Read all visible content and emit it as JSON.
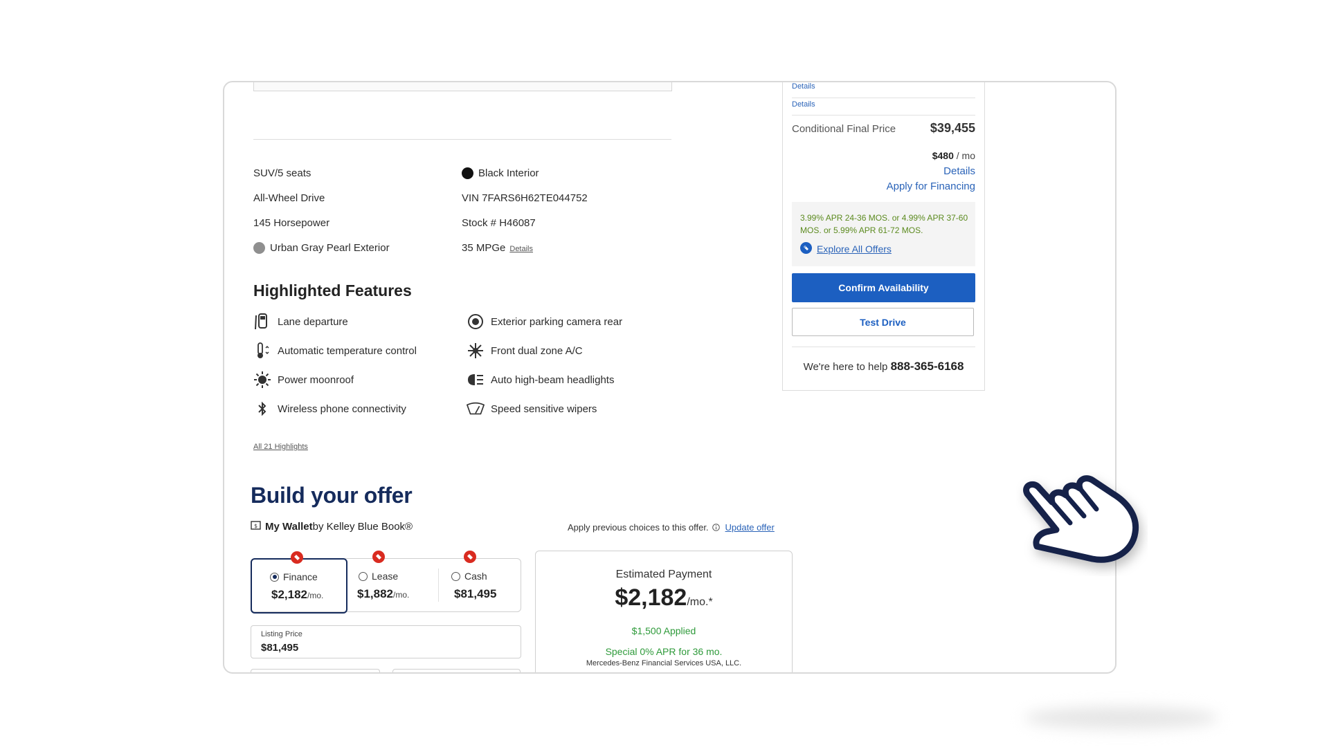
{
  "specs": {
    "left": [
      "SUV/5 seats",
      "All-Wheel Drive",
      "145 Horsepower",
      "Urban Gray Pearl Exterior"
    ],
    "right": [
      "Black Interior",
      "VIN 7FARS6H62TE044752",
      "Stock # H46087",
      "35 MPGe"
    ],
    "mpge_details": "Details"
  },
  "features": {
    "title": "Highlighted Features",
    "left": [
      {
        "label": "Lane departure",
        "icon": "lane-departure-icon"
      },
      {
        "label": "Automatic temperature control",
        "icon": "thermometer-icon"
      },
      {
        "label": "Power moonroof",
        "icon": "sun-icon"
      },
      {
        "label": "Wireless phone connectivity",
        "icon": "bluetooth-icon"
      }
    ],
    "right": [
      {
        "label": "Exterior parking camera rear",
        "icon": "camera-icon"
      },
      {
        "label": "Front dual zone A/C",
        "icon": "snowflake-icon"
      },
      {
        "label": "Auto high-beam headlights",
        "icon": "headlight-icon"
      },
      {
        "label": "Speed sensitive wipers",
        "icon": "wiper-icon"
      }
    ],
    "all_link": "All 21 Highlights"
  },
  "price_panel": {
    "details_1": "Details",
    "details_2": "Details",
    "final_label": "Conditional Final Price",
    "final_price": "$39,455",
    "monthly_amount": "$480",
    "monthly_unit": " / mo",
    "details_3": "Details",
    "apply_financing": "Apply for Financing",
    "offers_text": "3.99% APR 24-36 MOS. or 4.99% APR 37-60 MOS. or 5.99% APR 61-72 MOS.",
    "explore_offers": "Explore All Offers",
    "confirm_button": "Confirm Availability",
    "test_drive_button": "Test Drive",
    "help_text": "We're here to help ",
    "help_phone": "888-365-6168"
  },
  "offer": {
    "title": "Build your offer",
    "wallet_bold": "My Wallet",
    "wallet_rest": " by Kelley Blue Book®",
    "apply_previous": "Apply previous choices to this offer.",
    "update_offer": "Update offer",
    "options": [
      {
        "label": "Finance",
        "price": "$2,182",
        "unit": "/mo.",
        "selected": true
      },
      {
        "label": "Lease",
        "price": "$1,882",
        "unit": "/mo.",
        "selected": false
      },
      {
        "label": "Cash",
        "price": "$81,495",
        "unit": "",
        "selected": false
      }
    ],
    "listing_label": "Listing Price",
    "listing_value": "$81,495",
    "estimated": {
      "title": "Estimated Payment",
      "value": "$2,182",
      "unit": "/mo.*",
      "applied": "$1,500 Applied",
      "special": "Special 0% APR for 36 mo.",
      "lender": "Mercedes-Benz Financial Services USA, LLC."
    }
  },
  "colors": {
    "accent_blue": "#1c5fc1",
    "navy": "#152b5c",
    "offer_green": "#2e9a3a",
    "badge_red": "#d92b20"
  }
}
